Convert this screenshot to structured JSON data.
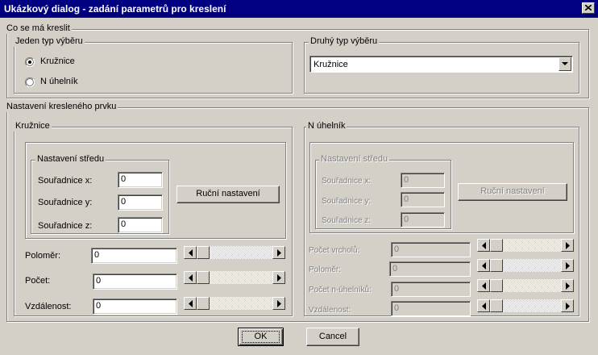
{
  "window": {
    "title": "Ukázkový dialog - zadání parametrů pro kreslení"
  },
  "what_to_draw": {
    "label": "Co se má kreslit",
    "first_selection": {
      "label": "Jeden typ výběru",
      "options": [
        {
          "label": "Kružnice",
          "selected": true
        },
        {
          "label": "N úhelník",
          "selected": false
        }
      ]
    },
    "second_selection": {
      "label": "Druhý typ výběru",
      "combo_value": "Kružnice"
    }
  },
  "element_settings": {
    "label": "Nastavení kresleného prvku",
    "circle": {
      "label": "Kružnice",
      "center": {
        "label": "Nastavení středu",
        "x_label": "Souřadnice x:",
        "x_value": "0",
        "y_label": "Souřadnice y:",
        "y_value": "0",
        "z_label": "Souřadnice z:",
        "z_value": "0"
      },
      "manual_button": "Ruční nastavení",
      "fields": [
        {
          "label": "Poloměr:",
          "value": "0"
        },
        {
          "label": "Počet:",
          "value": "0"
        },
        {
          "label": "Vzdálenost:",
          "value": "0"
        }
      ]
    },
    "polygon": {
      "label": "N úhelník",
      "center": {
        "label": "Nastavení středu",
        "x_label": "Souřadnice x:",
        "x_value": "0",
        "y_label": "Souřadnice y:",
        "y_value": "0",
        "z_label": "Souřadnice z:",
        "z_value": "0"
      },
      "manual_button": "Ruční nastavení",
      "fields": [
        {
          "label": "Počet vrcholů:",
          "value": "0"
        },
        {
          "label": "Poloměr:",
          "value": "0"
        },
        {
          "label": "Počet n-úhelníků:",
          "value": "0"
        },
        {
          "label": "Vzdálenost:",
          "value": "0"
        }
      ]
    }
  },
  "buttons": {
    "ok": "OK",
    "cancel": "Cancel"
  },
  "colors": {
    "title_bar": "#000080",
    "face": "#d4d0c8",
    "disabled_text": "#808080"
  }
}
